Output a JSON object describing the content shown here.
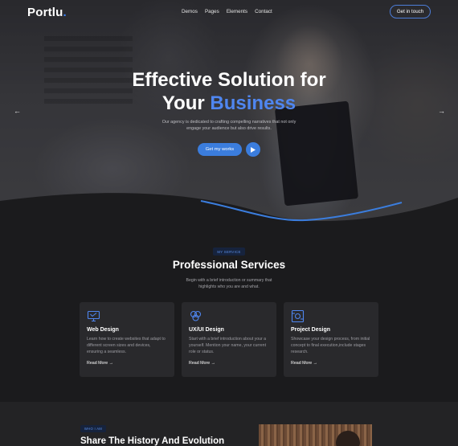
{
  "nav": {
    "logo_main": "Portlu",
    "logo_dot": ".",
    "items": [
      "Demos",
      "Pages",
      "Elements",
      "Contact"
    ],
    "cta": "Get in touch"
  },
  "hero": {
    "title_line1": "Effective Solution for",
    "title_line2_plain": "Your",
    "title_line2_accent": "Business",
    "subtitle": "Our agency is dedicated to crafting compelling narratives that not only engage your audience but also drive results.",
    "button": "Get my works",
    "prev": "←",
    "next": "→"
  },
  "services": {
    "badge": "MY SERVICE",
    "title": "Professional Services",
    "subtitle": "Begin with a brief introduction or summary that highlights who you are and what.",
    "cards": [
      {
        "title": "Web Design",
        "desc": "Learn how to create websites that adapt to different screen sizes and devices, ensuring a seamless.",
        "link": "Read More →",
        "icon": "monitor-icon"
      },
      {
        "title": "UX/UI Design",
        "desc": "Start with a brief introduction about your a yourself. Mention your name, your current role or status.",
        "link": "Read More →",
        "icon": "design-icon"
      },
      {
        "title": "Project Design",
        "desc": "Showcase your design process, from initial concept to final execution,include stages research.",
        "link": "Read More →",
        "icon": "project-icon"
      }
    ]
  },
  "about": {
    "badge": "WHO I AM",
    "title": "Share The History And Evolution"
  },
  "colors": {
    "accent": "#3b7ddd",
    "background": "#1b1b1d",
    "card": "#29292c"
  }
}
